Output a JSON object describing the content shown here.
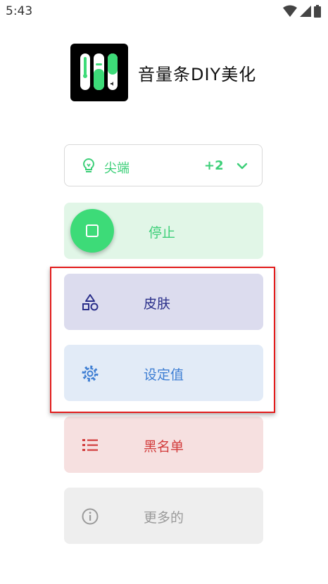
{
  "status_bar": {
    "time": "5:43"
  },
  "app": {
    "title": "音量条DIY美化"
  },
  "mode_selector": {
    "label": "尖端",
    "extra_count": "+2"
  },
  "menu": {
    "stop": "停止",
    "skin": "皮肤",
    "settings": "设定值",
    "blacklist": "黑名单",
    "more": "更多的"
  },
  "colors": {
    "green": "#3ddb78",
    "skin_fg": "#2a2f8a",
    "settings_fg": "#3e7ed3",
    "blacklist_fg": "#d23c3c",
    "more_fg": "#9a9a9a",
    "highlight": "#e21b1b"
  },
  "icons": [
    "wifi-icon",
    "signal-icon",
    "battery-icon",
    "lightbulb-icon",
    "chevron-down-icon",
    "stop-icon",
    "shapes-icon",
    "gear-icon",
    "list-icon",
    "info-icon"
  ]
}
